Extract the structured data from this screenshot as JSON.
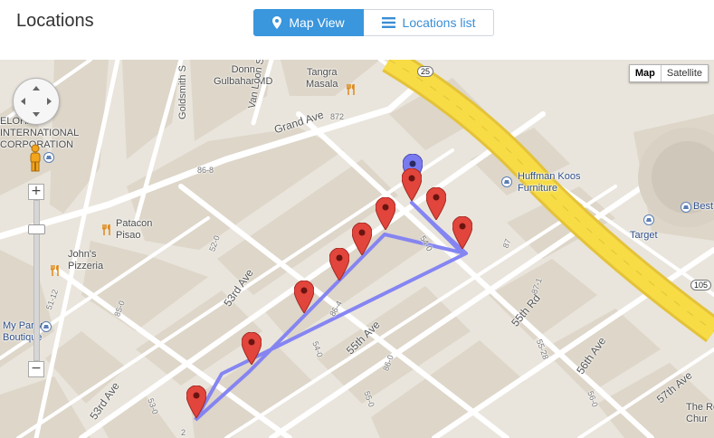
{
  "header": {
    "title": "Locations",
    "views": {
      "map_label": "Map View",
      "list_label": "Locations list",
      "active": "map"
    }
  },
  "map": {
    "type_control": {
      "map": "Map",
      "satellite": "Satellite",
      "active": "Map"
    },
    "zoom": {
      "in": "+",
      "out": "−"
    },
    "poi_labels": {
      "elohar": "ELOHAR\nINTERNATIONAL\nCORPORATION",
      "donn": "Donn\nGulbahar MD",
      "tangra": "Tangra\nMasala",
      "huffman": "Huffman Koos\nFurniture",
      "patacon": "Patacon\nPisao",
      "johns": "John's\nPizzeria",
      "party": "My Party\nBoutique",
      "target": "Target",
      "best": "Best",
      "church": "The Ro\nChur"
    },
    "street_labels": {
      "grand": "Grand Ave",
      "goldsmith": "Goldsmith S",
      "vanloon": "Van Loon S",
      "ave53": "53rd Ave",
      "ave53b": "53rd Ave",
      "ave55": "55th Ave",
      "rd55": "55th Rd",
      "ave56": "56th Ave",
      "ave57": "57th Ave"
    },
    "small_labels": [
      "872",
      "86-8",
      "52-0",
      "85-0",
      "51-12",
      "54-0",
      "86-4",
      "86-0",
      "54-0",
      "87",
      "87-1",
      "55-28",
      "55-0",
      "56-0",
      "53-0",
      "2"
    ],
    "highway_labels": {
      "top": "25",
      "right": "105"
    },
    "markers": {
      "selected_count": 1,
      "red_count": 9
    },
    "colors": {
      "land": "#e9e5dc",
      "block": "#dcd5c8",
      "road": "#ffffff",
      "highway": "#f7dc45",
      "route": "#7f7ff2",
      "marker_red": "#e2453c",
      "marker_selected": "#7a7af0",
      "accent": "#3a96dd"
    }
  }
}
